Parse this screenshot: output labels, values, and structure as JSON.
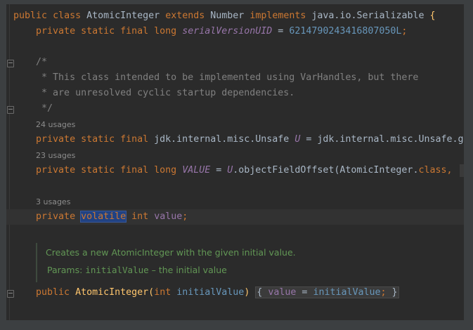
{
  "lines": {
    "class_decl": {
      "kw_public": "public",
      "kw_class": "class",
      "name": "AtomicInteger",
      "kw_extends": "extends",
      "super": "Number",
      "kw_implements": "implements",
      "iface": "java.io.Serializable",
      "brace": "{"
    },
    "serial": {
      "kw": "private static final long",
      "field": "serialVersionUID",
      "eq": " = ",
      "value": "6214790243416807050L",
      "semi": ";"
    },
    "comment": {
      "open": "/*",
      "line1": " * This class intended to be implemented using VarHandles, but there",
      "line2": " * are unresolved cyclic startup dependencies.",
      "close": " */"
    },
    "unsafe": {
      "usages": "24 usages",
      "kw": "private static final",
      "type": "jdk.internal.misc.Unsafe",
      "field": "U",
      "eq": " = ",
      "rhs": "jdk.internal.misc.Unsafe.g"
    },
    "value_offset": {
      "usages": "23 usages",
      "kw": "private static final long",
      "field": "VALUE",
      "eq": " = ",
      "u": "U",
      "call": ".objectFieldOffset(AtomicInteger.",
      "kw_class": "class",
      "comma": ","
    },
    "value_field": {
      "usages": "3 usages",
      "kw_private": "private",
      "kw_volatile": "volatile",
      "kw_int": "int",
      "field": "value",
      "semi": ";"
    },
    "javadoc": {
      "text": "Creates a new AtomicInteger with the given initial value.",
      "params_label": "Params:",
      "param_name": "initialValue",
      "param_desc": " – the initial value"
    },
    "constructor": {
      "kw_public": "public",
      "name": "AtomicInteger",
      "open": "(",
      "kw_int": "int",
      "param": "initialValue",
      "close": ")",
      "lbrace": "{",
      "field": "value",
      "eq": " = ",
      "rhs": "initialValue",
      "semi": ";",
      "rbrace": "}"
    }
  },
  "colors": {
    "keyword": "#cc7832",
    "field": "#9876aa",
    "number": "#6897bb",
    "comment": "#808080",
    "doc": "#629755",
    "method": "#ffc66d",
    "background": "#2b2b2b"
  }
}
